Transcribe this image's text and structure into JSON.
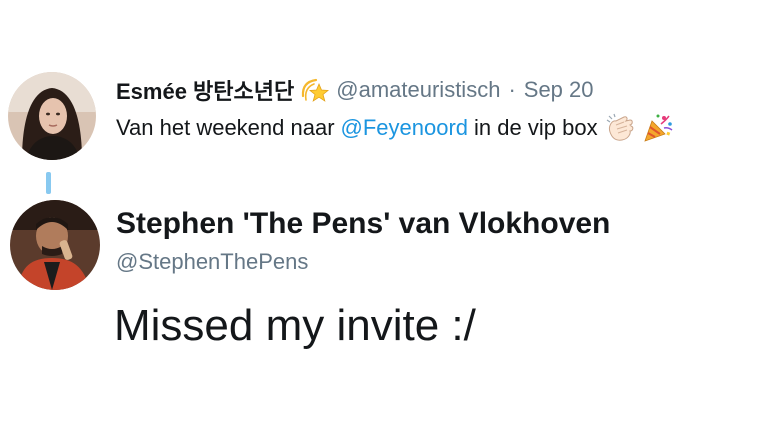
{
  "parent_tweet": {
    "author_name": "Esmée 방탄소년단",
    "author_badge_icon": "dizzy-star-icon",
    "handle": "@amateuristisch",
    "separator": "·",
    "date": "Sep 20",
    "text_before": "Van het weekend naar",
    "mention": "@Feyenoord",
    "text_after": "in de vip box",
    "emojis": [
      "clapping-hands-icon",
      "party-popper-icon"
    ]
  },
  "reply_tweet": {
    "author_name": "Stephen 'The Pens' van Vlokhoven",
    "handle": "@StephenThePens",
    "text": "Missed my invite :/"
  },
  "colors": {
    "text": "#14171a",
    "secondary": "#657786",
    "mention": "#1b95e0",
    "thread_line": "#88c9f0"
  }
}
